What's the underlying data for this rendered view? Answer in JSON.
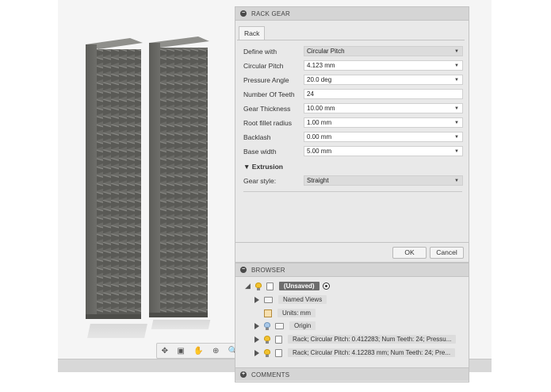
{
  "rack_gear_dialog": {
    "title": "RACK GEAR",
    "tab_label": "Rack",
    "fields": [
      {
        "label": "Define with",
        "value": "Circular Pitch",
        "type": "select"
      },
      {
        "label": "Circular Pitch",
        "value": "4.123 mm",
        "type": "input-dropdown"
      },
      {
        "label": "Pressure Angle",
        "value": "20.0 deg",
        "type": "input-dropdown"
      },
      {
        "label": "Number Of Teeth",
        "value": "24",
        "type": "input"
      },
      {
        "label": "Gear Thickness",
        "value": "10.00 mm",
        "type": "input-dropdown"
      },
      {
        "label": "Root fillet radius",
        "value": "1.00 mm",
        "type": "input-dropdown"
      },
      {
        "label": "Backlash",
        "value": "0.00 mm",
        "type": "input-dropdown"
      },
      {
        "label": "Base width",
        "value": "5.00 mm",
        "type": "input-dropdown"
      }
    ],
    "extrusion_section": "Extrusion",
    "gear_style": {
      "label": "Gear style:",
      "value": "Straight"
    },
    "ok_label": "OK",
    "cancel_label": "Cancel"
  },
  "browser": {
    "title": "BROWSER",
    "root_label": "(Unsaved)",
    "items": [
      {
        "label": "Named Views",
        "icon": "folder-icon"
      },
      {
        "label": "Units: mm",
        "icon": "units-icon"
      },
      {
        "label": "Origin",
        "icon": "folder-icon"
      },
      {
        "label": "Rack; Circular Pitch: 0.412283; Num Teeth: 24; Pressu...",
        "icon": "body-icon"
      },
      {
        "label": "Rack; Circular Pitch: 4.12283 mm; Num Teeth: 24; Pre...",
        "icon": "body-icon"
      }
    ]
  },
  "comments": {
    "title": "COMMENTS"
  },
  "colors": {
    "rack_dark": "#555551",
    "rack_light": "#8a8a86",
    "panel_bg": "#e9e9e9"
  }
}
